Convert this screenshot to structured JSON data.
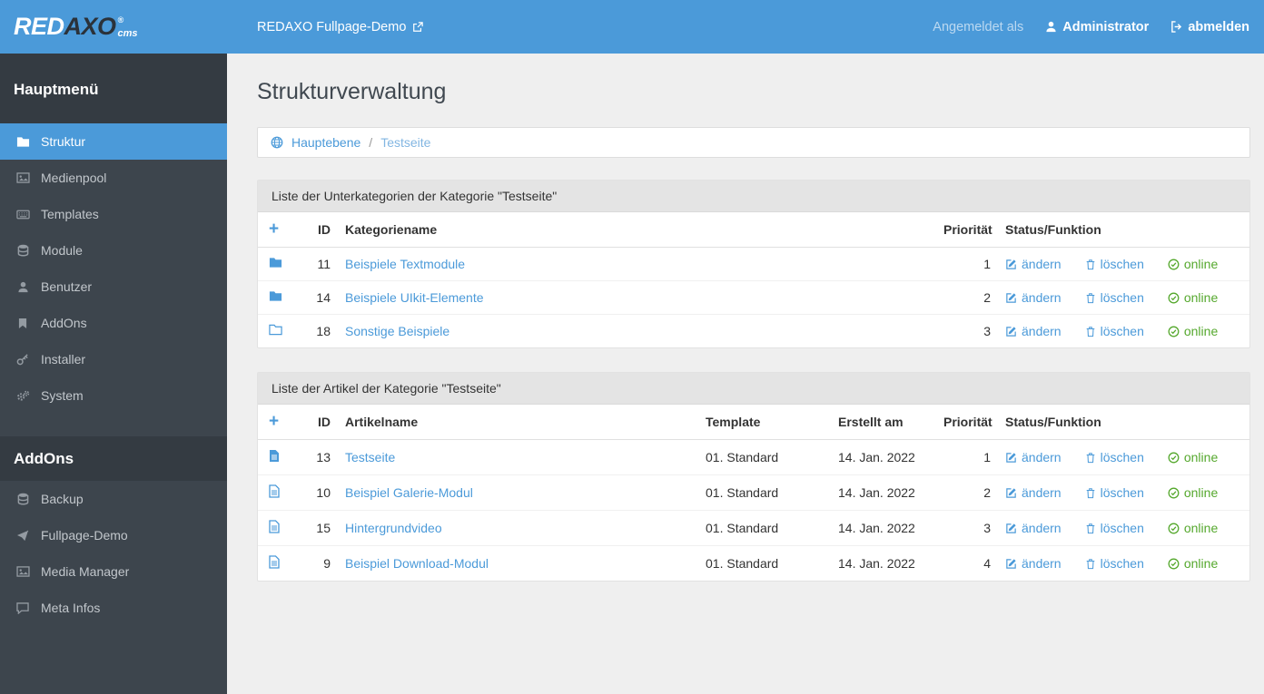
{
  "topbar": {
    "logo": {
      "part1": "RED",
      "part2": "AXO",
      "reg": "®",
      "sub": "cms"
    },
    "site_link": {
      "label": "REDAXO Fullpage-Demo",
      "icon": "external-link-icon"
    },
    "session": {
      "prefix": "Angemeldet als",
      "user": "Administrator",
      "user_icon": "user-icon",
      "logout": "abmelden",
      "logout_icon": "sign-out-icon"
    }
  },
  "sidebar": {
    "sections": [
      {
        "header": "Hauptmenü",
        "items": [
          {
            "label": "Struktur",
            "icon": "folder-icon",
            "active": true
          },
          {
            "label": "Medienpool",
            "icon": "image-icon",
            "active": false
          },
          {
            "label": "Templates",
            "icon": "template-icon",
            "active": false
          },
          {
            "label": "Module",
            "icon": "database-icon",
            "active": false
          },
          {
            "label": "Benutzer",
            "icon": "user-icon",
            "active": false
          },
          {
            "label": "AddOns",
            "icon": "bookmark-icon",
            "active": false
          },
          {
            "label": "Installer",
            "icon": "key-icon",
            "active": false
          },
          {
            "label": "System",
            "icon": "gears-icon",
            "active": false
          }
        ]
      },
      {
        "header": "AddOns",
        "items": [
          {
            "label": "Backup",
            "icon": "database-icon",
            "active": false
          },
          {
            "label": "Fullpage-Demo",
            "icon": "paper-plane-icon",
            "active": false
          },
          {
            "label": "Media Manager",
            "icon": "image-icon",
            "active": false
          },
          {
            "label": "Meta Infos",
            "icon": "comment-icon",
            "active": false
          }
        ]
      }
    ]
  },
  "main": {
    "page_title": "Strukturverwaltung",
    "breadcrumb": {
      "icon": "globe-icon",
      "root": "Hauptebene",
      "separator": "/",
      "current": "Testseite"
    },
    "categories": {
      "panel_title": "Liste der Unterkategorien der Kategorie \"Testseite\"",
      "add_label": "+",
      "columns": {
        "id": "ID",
        "name": "Kategoriename",
        "priority": "Priorität",
        "status": "Status/Funktion"
      },
      "actions": {
        "edit": "ändern",
        "delete": "löschen",
        "online": "online"
      },
      "rows": [
        {
          "id": "11",
          "name": "Beispiele Textmodule",
          "priority": "1",
          "icon": "folder-solid"
        },
        {
          "id": "14",
          "name": "Beispiele UIkit-Elemente",
          "priority": "2",
          "icon": "folder-solid"
        },
        {
          "id": "18",
          "name": "Sonstige Beispiele",
          "priority": "3",
          "icon": "folder-outline"
        }
      ]
    },
    "articles": {
      "panel_title": "Liste der Artikel der Kategorie \"Testseite\"",
      "add_label": "+",
      "columns": {
        "id": "ID",
        "name": "Artikelname",
        "template": "Template",
        "created": "Erstellt am",
        "priority": "Priorität",
        "status": "Status/Funktion"
      },
      "actions": {
        "edit": "ändern",
        "delete": "löschen",
        "online": "online"
      },
      "rows": [
        {
          "id": "13",
          "name": "Testseite",
          "template": "01. Standard",
          "created": "14. Jan. 2022",
          "priority": "1",
          "icon": "file-solid"
        },
        {
          "id": "10",
          "name": "Beispiel Galerie-Modul",
          "template": "01. Standard",
          "created": "14. Jan. 2022",
          "priority": "2",
          "icon": "file-outline"
        },
        {
          "id": "15",
          "name": "Hintergrundvideo",
          "template": "01. Standard",
          "created": "14. Jan. 2022",
          "priority": "3",
          "icon": "file-outline"
        },
        {
          "id": "9",
          "name": "Beispiel Download-Modul",
          "template": "01. Standard",
          "created": "14. Jan. 2022",
          "priority": "4",
          "icon": "file-outline"
        }
      ]
    }
  },
  "colors": {
    "topbar_blue": "#4b9ad9",
    "active_item_blue": "#4b9ad9",
    "sidebar_bg": "#3d454d",
    "sidebar_header_bg": "#343b42",
    "link_blue": "#4b9ad9",
    "breadcrumb_current_blue": "#82b6e2",
    "online_green": "#55a82d",
    "page_bg": "#efefef",
    "panel_header_bg": "#e4e4e4"
  }
}
